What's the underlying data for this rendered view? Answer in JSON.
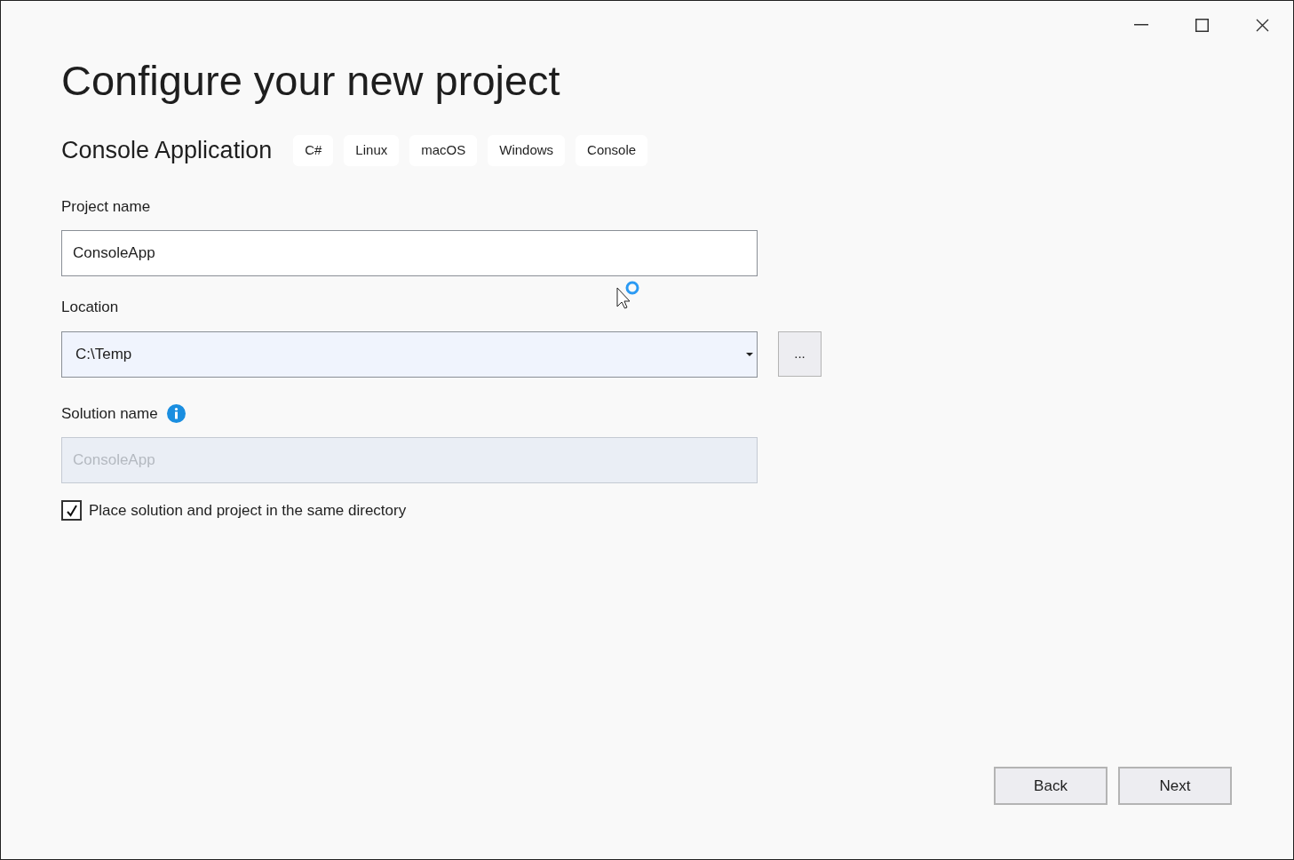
{
  "title": "Configure your new project",
  "template": {
    "name": "Console Application",
    "tags": [
      "C#",
      "Linux",
      "macOS",
      "Windows",
      "Console"
    ]
  },
  "project_name": {
    "label": "Project name",
    "value": "ConsoleApp",
    "disabled": false
  },
  "location": {
    "label": "Location",
    "value": "C:\\Temp",
    "browse_button": "..."
  },
  "solution_name": {
    "label": "Solution name",
    "value": "ConsoleApp",
    "disabled": true
  },
  "same_directory": {
    "label": "Place solution and project in the same directory",
    "checked": true
  },
  "buttons": [
    "Back",
    "Next"
  ]
}
